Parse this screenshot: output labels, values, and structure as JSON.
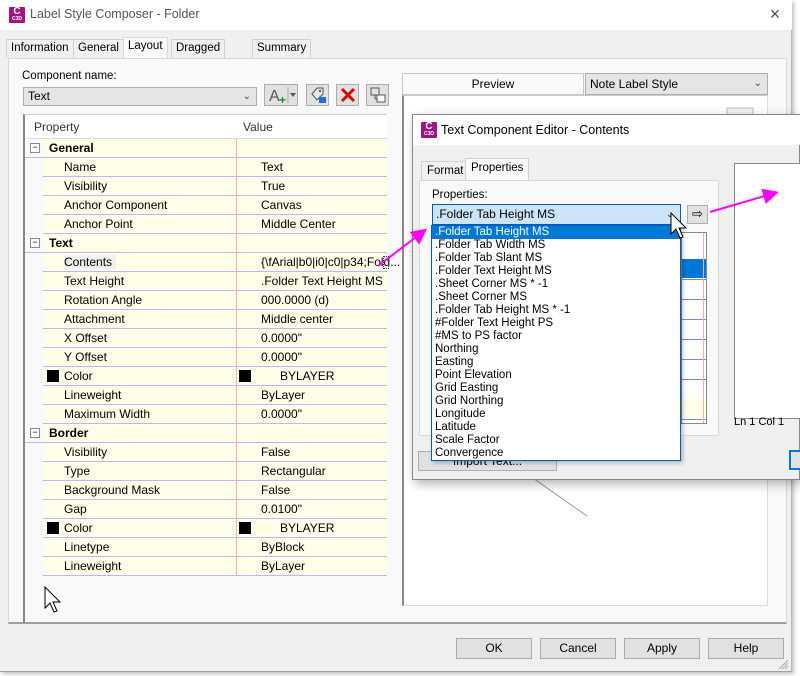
{
  "window": {
    "title": "Label Style Composer - Folder",
    "app_icon_letter": "C",
    "app_icon_sub": "C3D",
    "close_label": "×"
  },
  "tabs": [
    {
      "label": "Information",
      "active": false
    },
    {
      "label": "General",
      "active": false
    },
    {
      "label": "Layout",
      "active": true
    },
    {
      "label": "Dragged State",
      "active": false
    },
    {
      "label": "Summary",
      "active": false
    }
  ],
  "layout": {
    "component_name_label": "Component name:",
    "component_name_value": "Text",
    "toolbar": {
      "add_component_icon": "A+",
      "copy_component_icon": "tag-copy",
      "delete_component_icon": "✕",
      "draw_order_icon": "draw-order"
    },
    "grid": {
      "columns": [
        "Property",
        "Value"
      ],
      "sections": [
        {
          "name": "General",
          "rows": [
            {
              "property": "Name",
              "value": "Text"
            },
            {
              "property": "Visibility",
              "value": "True"
            },
            {
              "property": "Anchor Component",
              "value": "Canvas"
            },
            {
              "property": "Anchor Point",
              "value": "Middle Center"
            }
          ]
        },
        {
          "name": "Text",
          "rows": [
            {
              "property": "Contents",
              "value": "{\\fArial|b0|i0|c0|p34;Fold..."
            },
            {
              "property": "Text Height",
              "value": ".Folder Text Height MS"
            },
            {
              "property": "Rotation Angle",
              "value": "000.0000 (d)"
            },
            {
              "property": "Attachment",
              "value": "Middle center"
            },
            {
              "property": "X Offset",
              "value": "0.0000\""
            },
            {
              "property": "Y Offset",
              "value": "0.0000\""
            },
            {
              "property": "Color",
              "value": "BYLAYER",
              "swatch": "#000000"
            },
            {
              "property": "Lineweight",
              "value": "ByLayer"
            },
            {
              "property": "Maximum Width",
              "value": "0.0000\""
            }
          ]
        },
        {
          "name": "Border",
          "rows": [
            {
              "property": "Visibility",
              "value": "False"
            },
            {
              "property": "Type",
              "value": "Rectangular"
            },
            {
              "property": "Background Mask",
              "value": "False"
            },
            {
              "property": "Gap",
              "value": "0.0100\""
            },
            {
              "property": "Color",
              "value": "BYLAYER",
              "swatch": "#000000"
            },
            {
              "property": "Linetype",
              "value": "ByBlock"
            },
            {
              "property": "Lineweight",
              "value": "ByLayer"
            }
          ]
        }
      ]
    },
    "preview": {
      "tab_label": "Preview",
      "style_select": "Note Label Style"
    }
  },
  "buttons": {
    "ok": "OK",
    "cancel": "Cancel",
    "apply": "Apply",
    "help": "Help"
  },
  "text_editor": {
    "title": "Text Component Editor - Contents",
    "tabs": [
      {
        "label": "Format",
        "active": false
      },
      {
        "label": "Properties",
        "active": true
      }
    ],
    "properties_label": "Properties:",
    "properties_value": ".Folder Tab Height MS",
    "insert_arrow_icon": "⇨",
    "import_text_label": "Import Text...",
    "status": "Ln 1 Col 1",
    "dropdown_options": [
      ".Folder Tab Height MS",
      ".Folder Tab Width MS",
      ".Folder Tab Slant MS",
      ".Folder Text Height MS",
      ".Sheet Corner MS * -1",
      ".Sheet Corner MS",
      ".Folder Tab Height MS * -1",
      "#Folder Text Height PS",
      "#MS to PS factor",
      "Northing",
      "Easting",
      "Point Elevation",
      "Grid Easting",
      "Grid Northing",
      "Longitude",
      "Latitude",
      "Scale Factor",
      "Convergence"
    ],
    "selected_index": 0
  },
  "colors": {
    "accent": "#0078d7",
    "app_icon": "#a3157e",
    "annotation_arrow": "#ff00ff",
    "grid_row_bg": "#fefde8"
  }
}
